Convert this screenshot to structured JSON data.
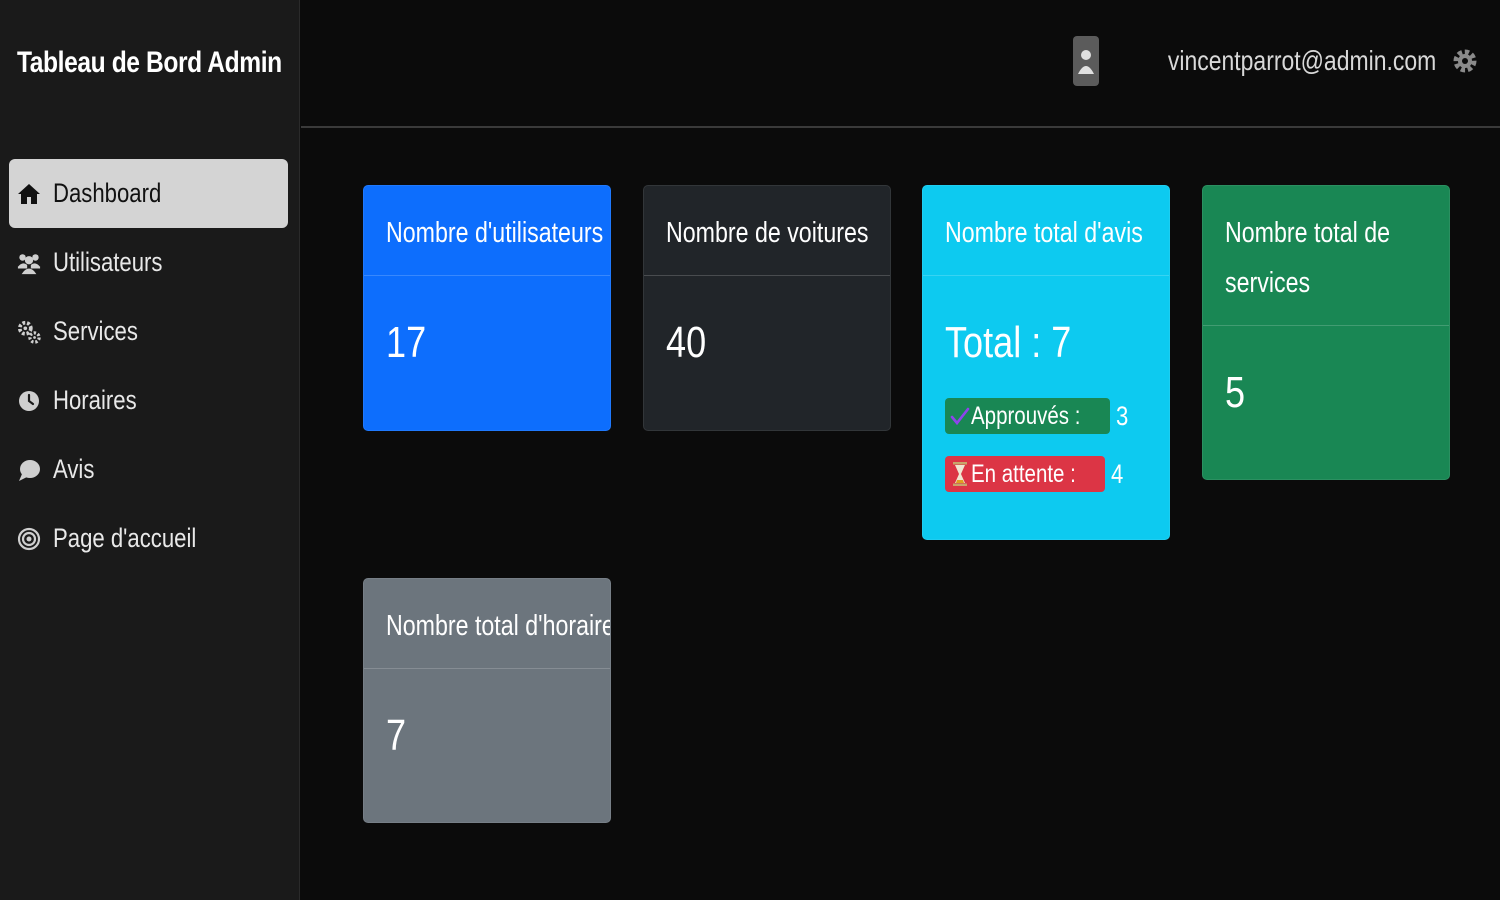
{
  "sidebar": {
    "brand": "Tableau de Bord Admin",
    "items": [
      {
        "label": "Dashboard",
        "icon": "home-icon",
        "active": true
      },
      {
        "label": "Utilisateurs",
        "icon": "users-icon"
      },
      {
        "label": "Services",
        "icon": "gears-icon"
      },
      {
        "label": "Horaires",
        "icon": "clock-icon"
      },
      {
        "label": "Avis",
        "icon": "chat-bubble-icon"
      },
      {
        "label": "Page d'accueil",
        "icon": "target-icon"
      }
    ]
  },
  "header": {
    "email": "vincentparrot@admin.com",
    "icons": [
      "user-avatar-icon",
      "gear-icon"
    ]
  },
  "cards": {
    "users": {
      "title": "Nombre d'utilisateurs",
      "value": "17",
      "color": "#0d6efd"
    },
    "cars": {
      "title": "Nombre de voitures",
      "value": "40",
      "color": "#212529"
    },
    "reviews": {
      "title": "Nombre total d'avis",
      "total": "Total : 7",
      "color": "#0dcaf0",
      "approved_label": "Approuvés :",
      "approved_count": "3",
      "approved_color": "#198754",
      "pending_label": "En attente :",
      "pending_count": "4",
      "pending_color": "#dc3545"
    },
    "services": {
      "title_line1": "Nombre total de",
      "title_line2": "services",
      "value": "5",
      "color": "#198754"
    },
    "hours": {
      "title": "Nombre total d'horaires",
      "value": "7",
      "color": "#6c757d"
    }
  }
}
